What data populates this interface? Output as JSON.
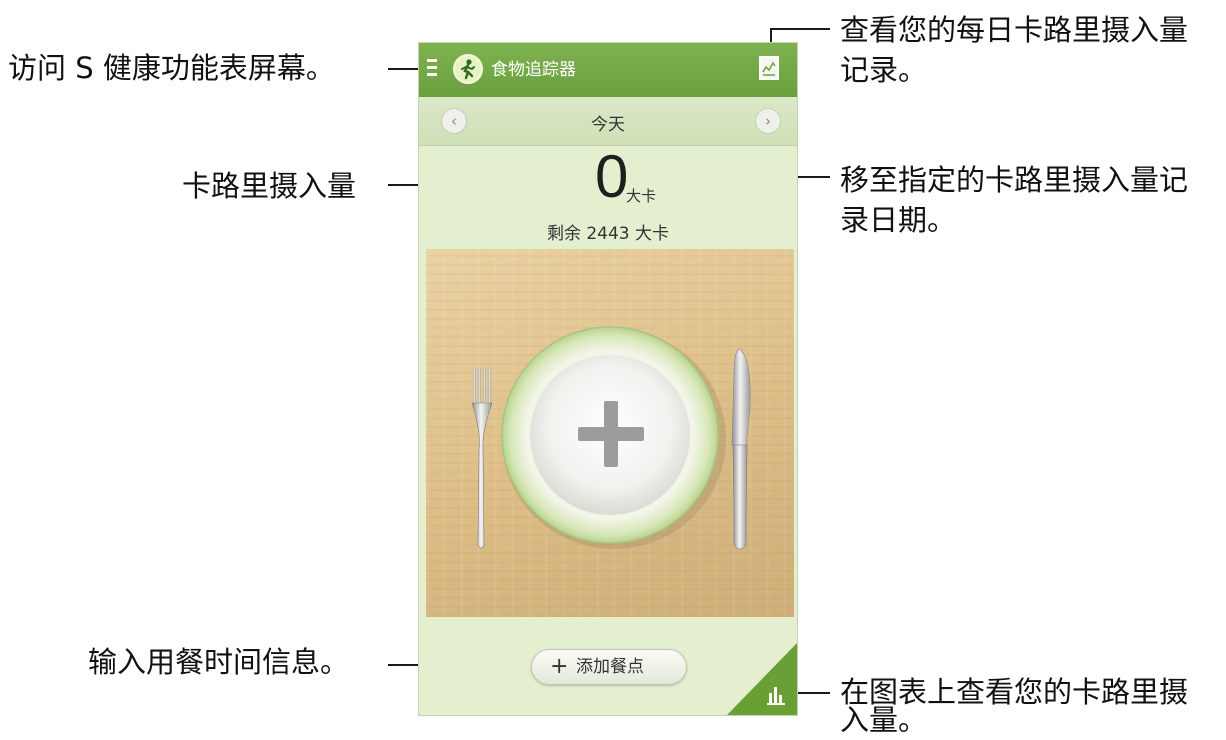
{
  "callouts": {
    "menu": "访问 S 健康功能表屏幕。",
    "daily_records_line1": "查看您的每日卡路里摄入量",
    "daily_records_line2": "记录。",
    "move_date_line1": "移至指定的卡路里摄入量记",
    "move_date_line2": "录日期。",
    "calorie_intake": "卡路里摄入量",
    "input_meal": "输入用餐时间信息。",
    "graph_line1": "在图表上查看您的卡路里摄",
    "graph_line2": "入量。"
  },
  "app": {
    "title": "食物追踪器",
    "icons": {
      "menu": "menu-icon",
      "app": "walking-person-icon",
      "records": "chart-record-icon",
      "graph": "bar-chart-icon"
    }
  },
  "date_nav": {
    "label": "今天",
    "prev": "‹",
    "next": "›"
  },
  "intake": {
    "value": "0",
    "unit": "大卡",
    "remaining": "剩余 2443 大卡"
  },
  "add_meal": {
    "plus": "+",
    "label": "添加餐点"
  },
  "colors": {
    "titlebar": "#6aa040",
    "background": "#e3efcf",
    "graph_tab": "#6a9f35"
  }
}
